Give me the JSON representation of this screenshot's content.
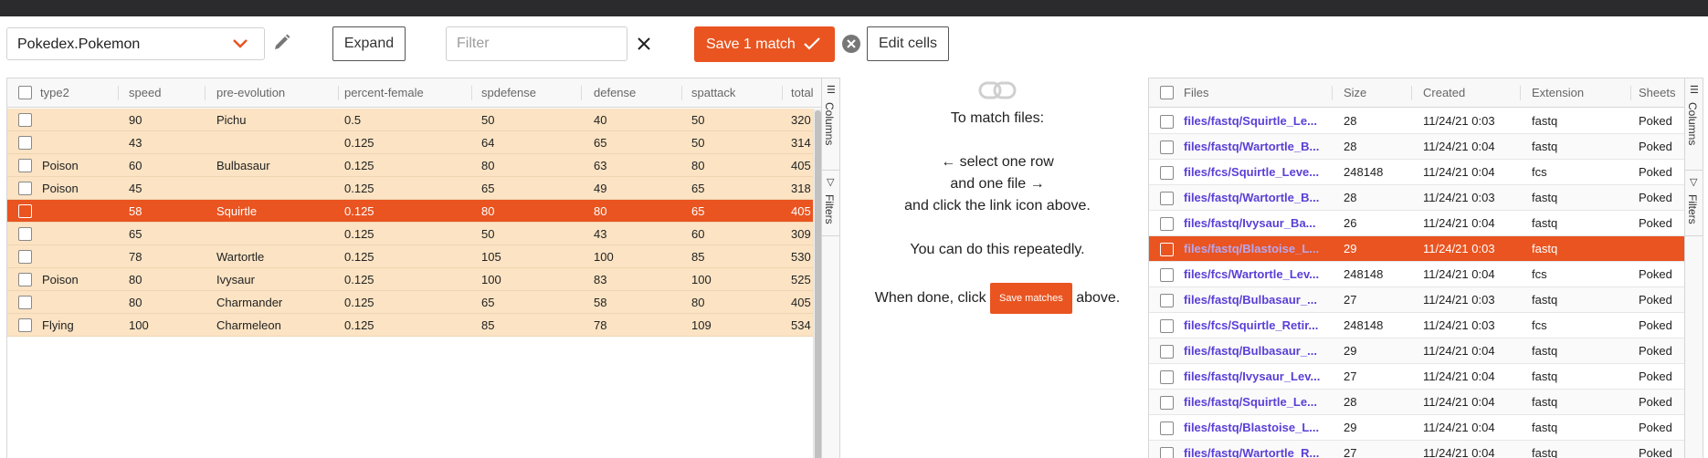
{
  "toolbar": {
    "dataset": "Pokedex.Pokemon",
    "expand_label": "Expand",
    "filter_placeholder": "Filter",
    "save_label": "Save 1 match",
    "edit_cells_label": "Edit cells"
  },
  "colors": {
    "accent": "#e95420",
    "row_highlight": "#fbe3c3",
    "link": "#5a3fd6"
  },
  "left_table": {
    "columns": [
      "type2",
      "speed",
      "pre-evolution",
      "percent-female",
      "spdefense",
      "defense",
      "spattack",
      "total"
    ],
    "rows": [
      {
        "type2": "",
        "speed": "90",
        "pre": "Pichu",
        "pf": "0.5",
        "spdef": "50",
        "def": "40",
        "spatk": "50",
        "total": "320"
      },
      {
        "type2": "",
        "speed": "43",
        "pre": "",
        "pf": "0.125",
        "spdef": "64",
        "def": "65",
        "spatk": "50",
        "total": "314"
      },
      {
        "type2": "Poison",
        "speed": "60",
        "pre": "Bulbasaur",
        "pf": "0.125",
        "spdef": "80",
        "def": "63",
        "spatk": "80",
        "total": "405"
      },
      {
        "type2": "Poison",
        "speed": "45",
        "pre": "",
        "pf": "0.125",
        "spdef": "65",
        "def": "49",
        "spatk": "65",
        "total": "318"
      },
      {
        "type2": "",
        "speed": "58",
        "pre": "Squirtle",
        "pf": "0.125",
        "spdef": "80",
        "def": "80",
        "spatk": "65",
        "total": "405"
      },
      {
        "type2": "",
        "speed": "65",
        "pre": "",
        "pf": "0.125",
        "spdef": "50",
        "def": "43",
        "spatk": "60",
        "total": "309"
      },
      {
        "type2": "",
        "speed": "78",
        "pre": "Wartortle",
        "pf": "0.125",
        "spdef": "105",
        "def": "100",
        "spatk": "85",
        "total": "530"
      },
      {
        "type2": "Poison",
        "speed": "80",
        "pre": "Ivysaur",
        "pf": "0.125",
        "spdef": "100",
        "def": "83",
        "spatk": "100",
        "total": "525"
      },
      {
        "type2": "",
        "speed": "80",
        "pre": "Charmander",
        "pf": "0.125",
        "spdef": "65",
        "def": "58",
        "spatk": "80",
        "total": "405"
      },
      {
        "type2": "Flying",
        "speed": "100",
        "pre": "Charmeleon",
        "pf": "0.125",
        "spdef": "85",
        "def": "78",
        "spatk": "109",
        "total": "534"
      }
    ]
  },
  "side_panel": {
    "columns_label": "Columns",
    "filters_label": "Filters"
  },
  "instructions": {
    "line1": "To match files:",
    "line2": "← select one row",
    "line3": "and one file →",
    "line4": "and click the link icon above.",
    "line5": "You can do this repeatedly.",
    "line6_pre": "When done, click",
    "line6_btn": "Save matches",
    "line6_post": "above."
  },
  "right_table": {
    "columns": [
      "Files",
      "Size",
      "Created",
      "Extension",
      "Sheets"
    ],
    "rows": [
      {
        "file": "files/fastq/Squirtle_Le...",
        "size": "28",
        "created": "11/24/21 0:03",
        "ext": "fastq",
        "sheets": "Poked"
      },
      {
        "file": "files/fastq/Wartortle_B...",
        "size": "28",
        "created": "11/24/21 0:04",
        "ext": "fastq",
        "sheets": "Poked"
      },
      {
        "file": "files/fcs/Squirtle_Leve...",
        "size": "248148",
        "created": "11/24/21 0:04",
        "ext": "fcs",
        "sheets": "Poked"
      },
      {
        "file": "files/fastq/Wartortle_B...",
        "size": "28",
        "created": "11/24/21 0:03",
        "ext": "fastq",
        "sheets": "Poked"
      },
      {
        "file": "files/fastq/Ivysaur_Ba...",
        "size": "26",
        "created": "11/24/21 0:04",
        "ext": "fastq",
        "sheets": "Poked"
      },
      {
        "file": "files/fastq/Blastoise_L...",
        "size": "29",
        "created": "11/24/21 0:03",
        "ext": "fastq",
        "sheets": ""
      },
      {
        "file": "files/fcs/Wartortle_Lev...",
        "size": "248148",
        "created": "11/24/21 0:04",
        "ext": "fcs",
        "sheets": "Poked"
      },
      {
        "file": "files/fastq/Bulbasaur_...",
        "size": "27",
        "created": "11/24/21 0:03",
        "ext": "fastq",
        "sheets": "Poked"
      },
      {
        "file": "files/fcs/Squirtle_Retir...",
        "size": "248148",
        "created": "11/24/21 0:03",
        "ext": "fcs",
        "sheets": "Poked"
      },
      {
        "file": "files/fastq/Bulbasaur_...",
        "size": "29",
        "created": "11/24/21 0:04",
        "ext": "fastq",
        "sheets": "Poked"
      },
      {
        "file": "files/fastq/Ivysaur_Lev...",
        "size": "27",
        "created": "11/24/21 0:04",
        "ext": "fastq",
        "sheets": "Poked"
      },
      {
        "file": "files/fastq/Squirtle_Le...",
        "size": "28",
        "created": "11/24/21 0:04",
        "ext": "fastq",
        "sheets": "Poked"
      },
      {
        "file": "files/fastq/Blastoise_L...",
        "size": "29",
        "created": "11/24/21 0:04",
        "ext": "fastq",
        "sheets": "Poked"
      },
      {
        "file": "files/fastq/Wartortle_R...",
        "size": "27",
        "created": "11/24/21 0:04",
        "ext": "fastq",
        "sheets": "Poked"
      }
    ]
  }
}
